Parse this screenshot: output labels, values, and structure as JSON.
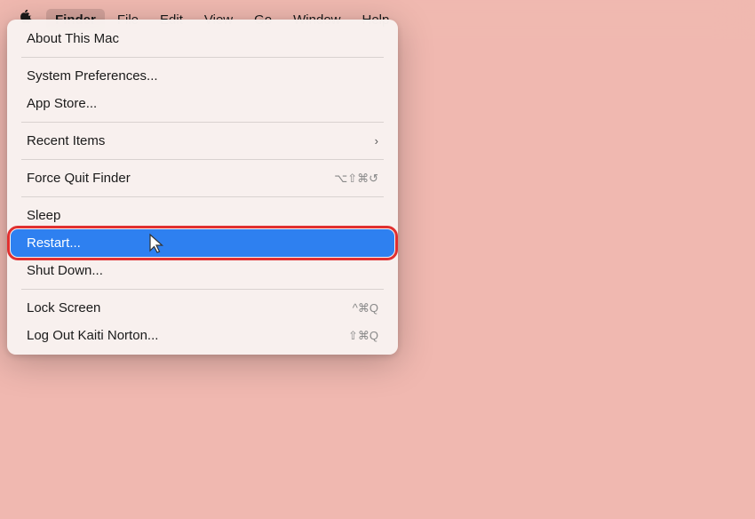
{
  "background_color": "#f0b8b0",
  "menu_bar": {
    "apple_label": "",
    "items": [
      {
        "label": "Finder",
        "active": true,
        "bold": true
      },
      {
        "label": "File",
        "active": false
      },
      {
        "label": "Edit",
        "active": false
      },
      {
        "label": "View",
        "active": false
      },
      {
        "label": "Go",
        "active": false
      },
      {
        "label": "Window",
        "active": false
      },
      {
        "label": "Help",
        "active": false
      }
    ]
  },
  "dropdown": {
    "items": [
      {
        "id": "about",
        "label": "About This Mac",
        "shortcut": "",
        "type": "item",
        "separator_after": true
      },
      {
        "id": "system-prefs",
        "label": "System Preferences...",
        "shortcut": "",
        "type": "item"
      },
      {
        "id": "app-store",
        "label": "App Store...",
        "shortcut": "",
        "type": "item",
        "separator_after": true
      },
      {
        "id": "recent-items",
        "label": "Recent Items",
        "shortcut": "›",
        "type": "submenu",
        "separator_after": true
      },
      {
        "id": "force-quit",
        "label": "Force Quit Finder",
        "shortcut": "⌥⇧⌘↺",
        "type": "item",
        "separator_after": true
      },
      {
        "id": "sleep",
        "label": "Sleep",
        "shortcut": "",
        "type": "item"
      },
      {
        "id": "restart",
        "label": "Restart...",
        "shortcut": "",
        "type": "item",
        "highlighted": true
      },
      {
        "id": "shut-down",
        "label": "Shut Down...",
        "shortcut": "",
        "type": "item",
        "separator_after": true
      },
      {
        "id": "lock-screen",
        "label": "Lock Screen",
        "shortcut": "^⌘Q",
        "type": "item"
      },
      {
        "id": "log-out",
        "label": "Log Out Kaiti Norton...",
        "shortcut": "⇧⌘Q",
        "type": "item"
      }
    ]
  },
  "icons": {
    "apple": "🍎",
    "chevron_right": "›"
  }
}
